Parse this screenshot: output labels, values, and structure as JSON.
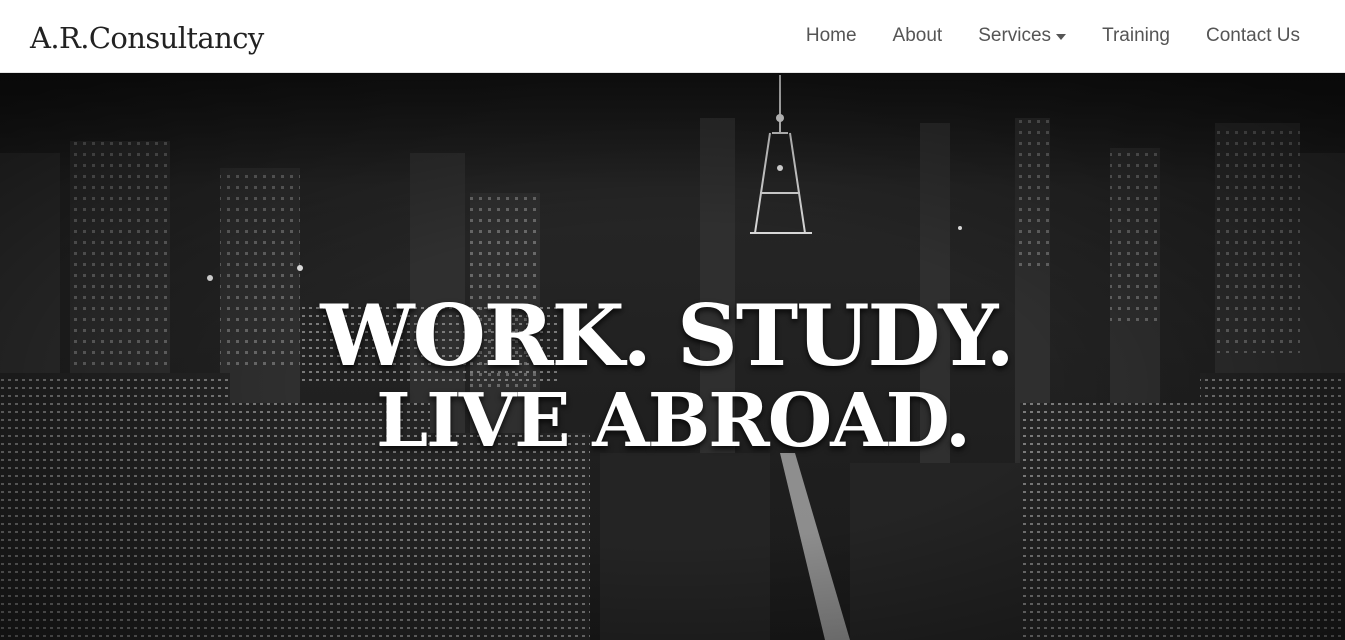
{
  "navbar": {
    "brand": "A.R.Consultancy",
    "items": [
      {
        "label": "Home"
      },
      {
        "label": "About"
      },
      {
        "label": "Services",
        "has_dropdown": true
      },
      {
        "label": "Training"
      },
      {
        "label": "Contact Us"
      }
    ]
  },
  "hero": {
    "headline_line1": "WORK. STUDY.",
    "headline_line2": "LIVE ABROAD.",
    "background": "night-city-skyline-image"
  },
  "colors": {
    "navbar_bg": "#ffffff",
    "nav_text": "#555555",
    "brand_text": "#222222",
    "hero_text": "#ffffff"
  }
}
